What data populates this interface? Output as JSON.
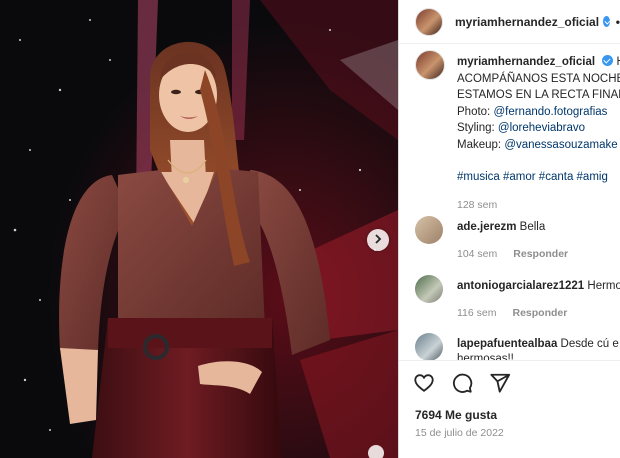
{
  "post": {
    "username": "myriamhernandez_oficial",
    "more": "•",
    "caption_lines": [
      "ACOMPÁÑANOS ESTA NOCHE",
      "ESTAMOS EN LA RECTA FINAL"
    ],
    "caption_start": "H",
    "credits": {
      "photo_label": "Photo:",
      "photo_link": "@fernando.fotografias",
      "styling_label": "Styling:",
      "styling_link": "@loreheviabravo",
      "makeup_label": "Makeup:",
      "makeup_link": "@vanessasouzamake"
    },
    "hashtags": "#musica #amor #canta #amig",
    "time": "128 sem"
  },
  "comments": [
    {
      "username": "ade.jerezm",
      "text": "Bella",
      "time": "104 sem",
      "reply": "Responder"
    },
    {
      "username": "antoniogarcialarez1221",
      "text": "Hermo",
      "time": "116 sem",
      "reply": "Responder"
    },
    {
      "username": "lapepafuentealbaa",
      "text": "Desde cú e",
      "text2": "hermosas!!",
      "time": "",
      "reply": ""
    }
  ],
  "likes": "7694 Me gusta",
  "date": "15 de julio de 2022",
  "icons": [
    "heart-icon",
    "comment-icon",
    "share-icon",
    "chevron-right-icon"
  ],
  "colors": {
    "link": "#00376b",
    "verified": "#3897f0",
    "muted": "#8e8e8e"
  }
}
